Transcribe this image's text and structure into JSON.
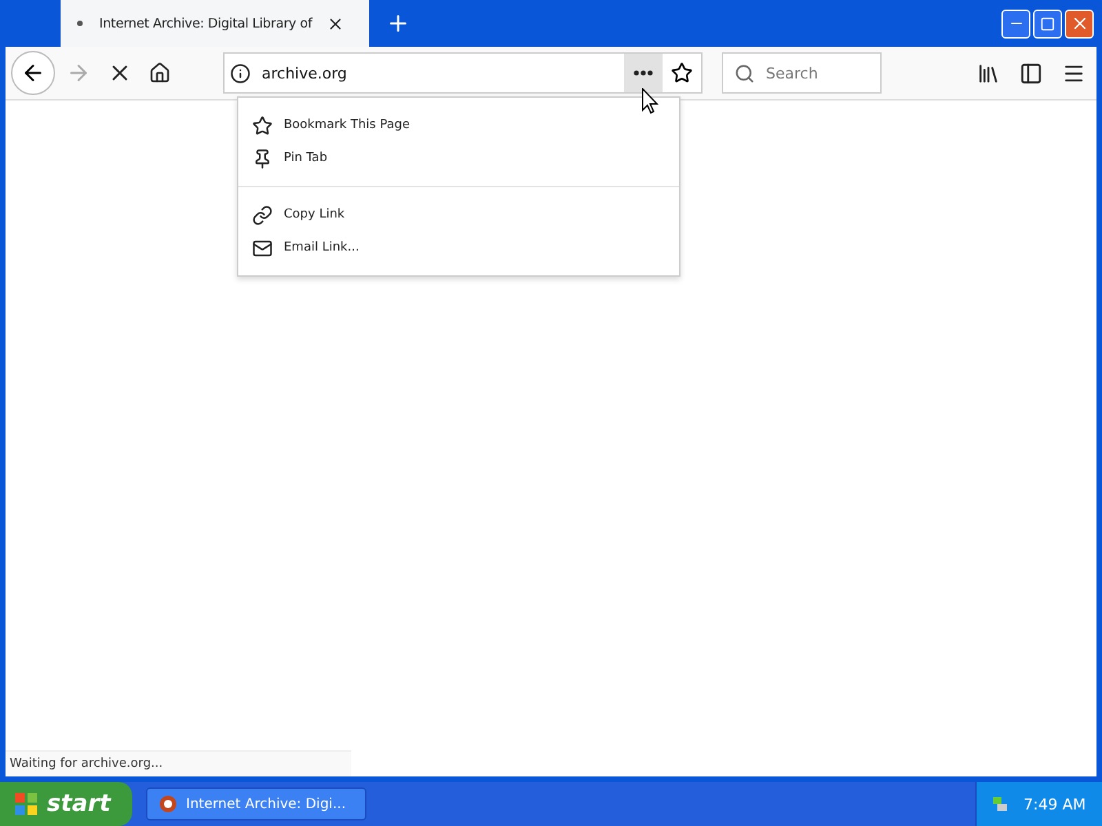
{
  "tab": {
    "title": "Internet Archive: Digital Library of",
    "loading": true
  },
  "toolbar": {
    "forward_enabled": false,
    "url": "archive.org",
    "search_placeholder": "Search",
    "page_actions_open": true
  },
  "page_actions_menu": {
    "groups": [
      [
        {
          "kind": "star",
          "label": "Bookmark This Page"
        },
        {
          "kind": "pin",
          "label": "Pin Tab"
        }
      ],
      [
        {
          "kind": "link",
          "label": "Copy Link"
        },
        {
          "kind": "mail",
          "label": "Email Link..."
        }
      ]
    ]
  },
  "status": "Waiting for archive.org...",
  "taskbar": {
    "start": "start",
    "task": "Internet Archive: Digi...",
    "clock": "7:49 AM"
  }
}
